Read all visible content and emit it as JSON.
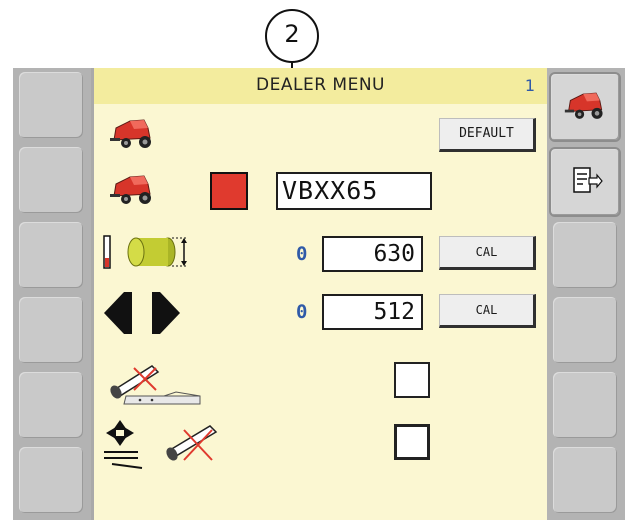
{
  "callout": {
    "label": "2"
  },
  "header": {
    "title": "DEALER MENU",
    "page_number": "1"
  },
  "rows": {
    "default_row": {
      "icon": "baler-icon",
      "button_label": "DEFAULT"
    },
    "model_row": {
      "icon": "baler-icon",
      "color": "#e03a2e",
      "model_value": "VBXX65"
    },
    "bale_size_row": {
      "icon": "bale-diameter-icon",
      "indicator": "0",
      "value": "630",
      "button_label": "CAL"
    },
    "chamber_row": {
      "icon": "chamber-arrows-icon",
      "indicator": "0",
      "value": "512",
      "button_label": "CAL"
    },
    "knife_row": {
      "icon": "knife-disabled-icon",
      "checked": false
    },
    "tilt_row": {
      "icon": "tilt-disabled-icon",
      "checked": false
    }
  },
  "right_softkeys": [
    {
      "icon": "baler-icon"
    },
    {
      "icon": "exit-menu-icon"
    }
  ],
  "colors": {
    "panel": "#fbf7d2",
    "header": "#f3ec9e",
    "accent_red": "#e03a2e",
    "blue_text": "#2f5aa8"
  }
}
